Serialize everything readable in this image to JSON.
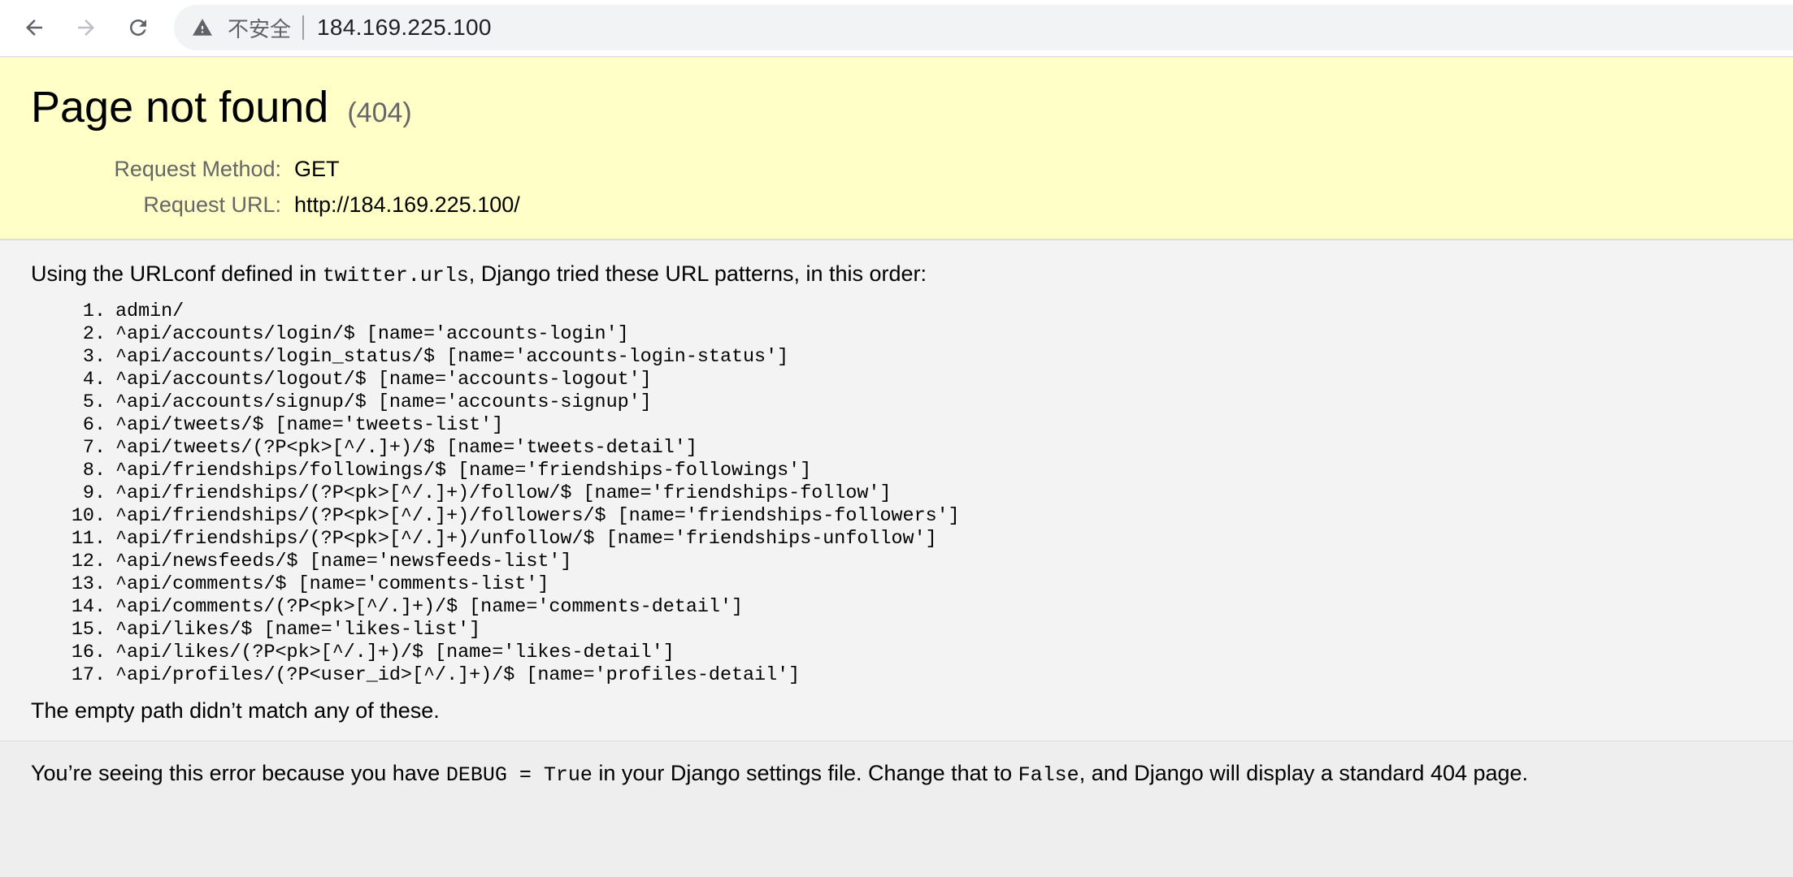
{
  "browser": {
    "security_label": "不安全",
    "address": "184.169.225.100"
  },
  "summary": {
    "title": "Page not found",
    "status": "(404)",
    "request_method_label": "Request Method:",
    "request_method_value": "GET",
    "request_url_label": "Request URL:",
    "request_url_value": "http://184.169.225.100/"
  },
  "info": {
    "intro_before": "Using the URLconf defined in ",
    "urlconf": "twitter.urls",
    "intro_after": ", Django tried these URL patterns, in this order:",
    "patterns": [
      {
        "num": "1.",
        "text": "admin/"
      },
      {
        "num": "2.",
        "text": "^api/accounts/login/$ [name='accounts-login']"
      },
      {
        "num": "3.",
        "text": "^api/accounts/login_status/$ [name='accounts-login-status']"
      },
      {
        "num": "4.",
        "text": "^api/accounts/logout/$ [name='accounts-logout']"
      },
      {
        "num": "5.",
        "text": "^api/accounts/signup/$ [name='accounts-signup']"
      },
      {
        "num": "6.",
        "text": "^api/tweets/$ [name='tweets-list']"
      },
      {
        "num": "7.",
        "text": "^api/tweets/(?P<pk>[^/.]+)/$ [name='tweets-detail']"
      },
      {
        "num": "8.",
        "text": "^api/friendships/followings/$ [name='friendships-followings']"
      },
      {
        "num": "9.",
        "text": "^api/friendships/(?P<pk>[^/.]+)/follow/$ [name='friendships-follow']"
      },
      {
        "num": "10.",
        "text": "^api/friendships/(?P<pk>[^/.]+)/followers/$ [name='friendships-followers']"
      },
      {
        "num": "11.",
        "text": "^api/friendships/(?P<pk>[^/.]+)/unfollow/$ [name='friendships-unfollow']"
      },
      {
        "num": "12.",
        "text": "^api/newsfeeds/$ [name='newsfeeds-list']"
      },
      {
        "num": "13.",
        "text": "^api/comments/$ [name='comments-list']"
      },
      {
        "num": "14.",
        "text": "^api/comments/(?P<pk>[^/.]+)/$ [name='comments-detail']"
      },
      {
        "num": "15.",
        "text": "^api/likes/$ [name='likes-list']"
      },
      {
        "num": "16.",
        "text": "^api/likes/(?P<pk>[^/.]+)/$ [name='likes-detail']"
      },
      {
        "num": "17.",
        "text": "^api/profiles/(?P<user_id>[^/.]+)/$ [name='profiles-detail']"
      }
    ],
    "outro": "The empty path didn’t match any of these."
  },
  "explanation": {
    "part1": "You’re seeing this error because you have ",
    "code1": "DEBUG = True",
    "part2": " in your Django settings file. Change that to ",
    "code2": "False",
    "part3": ", and Django will display a standard 404 page."
  },
  "colors": {
    "summary_bg": "#ffffc8",
    "info_bg": "#f3f3f3",
    "explanation_bg": "#eeeeee"
  }
}
